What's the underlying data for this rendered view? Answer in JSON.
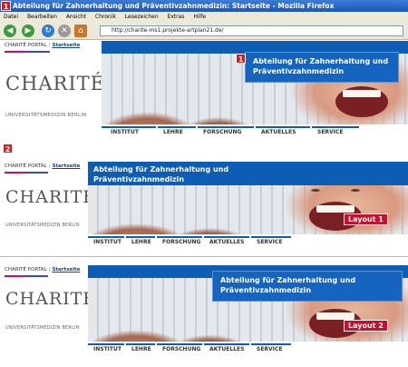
{
  "window": {
    "title": "Abteilung für Zahnerhaltung und Präventivzahnmedizin: Startseite - Mozilla Firefox"
  },
  "menus": [
    "Datei",
    "Bearbeiten",
    "Ansicht",
    "Chronik",
    "Lesezeichen",
    "Extras",
    "Hilfe"
  ],
  "address": {
    "url": "http://charite-ms1.projekte-artplan21.de/"
  },
  "markers": {
    "window": "1",
    "layout1": "1",
    "section2": "2"
  },
  "site": {
    "portal_label": "CHARITÉ PORTAL",
    "separator": "|",
    "startseite": "Startseite",
    "logo_text": "CHARITÉ",
    "subtitle": "UNIVERSITÄTSMEDIZIN BERLIN",
    "heading_line1": "Abteilung für Zahnerhaltung und",
    "heading_line2": "Präventivzahnmedizin",
    "nav": [
      "INSTITUT",
      "LEHRE",
      "FORSCHUNG",
      "AKTUELLES",
      "SERVICE"
    ]
  },
  "layouts": {
    "label1": "Layout 1",
    "label2": "Layout 2"
  },
  "colors": {
    "brand_blue": "#0d5db5",
    "marker_red": "#d21e1e",
    "layout_red": "#c8102e"
  }
}
